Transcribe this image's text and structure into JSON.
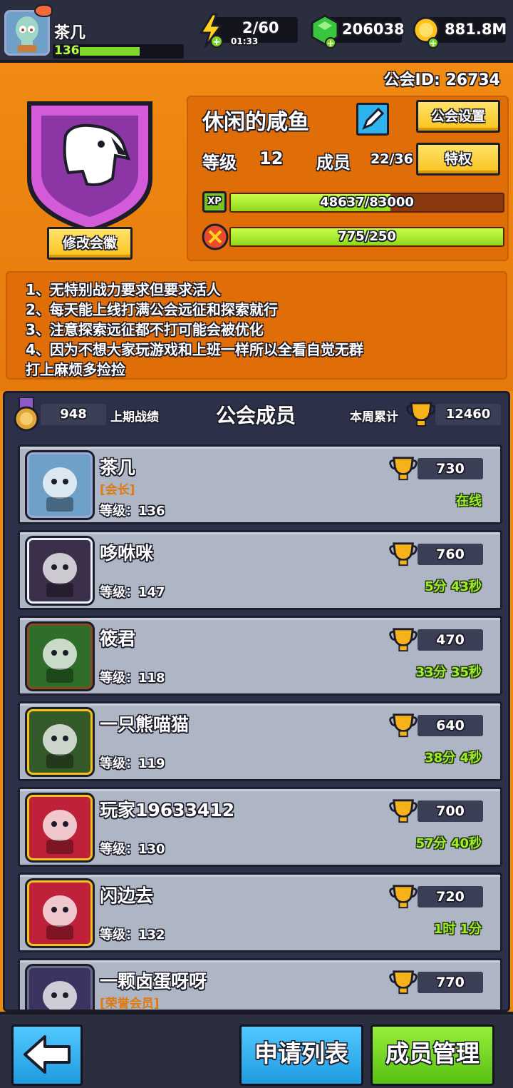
{
  "player": {
    "name": "茶几",
    "level": "136",
    "level_progress": 0.6
  },
  "resources": {
    "energy": "2/60",
    "energy_timer": "01:33",
    "gems": "206038",
    "coins": "881.8M"
  },
  "guild": {
    "id_label": "公会ID: 26734",
    "name": "休闲的咸鱼",
    "settings_button": "公会设置",
    "level_label": "等级",
    "level": "12",
    "members_label": "成员",
    "members_count": "22/36",
    "privilege_button": "特权",
    "xp_icon": "XP",
    "xp_text": "48637/83000",
    "xp_progress": 0.586,
    "battle_text": "775/250",
    "battle_progress": 1.0,
    "change_emblem_button": "修改会徽",
    "notice": [
      "1、无特别战力要求但要求活人",
      "2、每天能上线打满公会远征和探索就行",
      "3、注意探索远征都不打可能会被优化",
      "4、因为不想大家玩游戏和上班一样所以全看自觉无群",
      "打上麻烦多捡捡"
    ]
  },
  "members_panel": {
    "medal_value": "948",
    "last_label": "上期战绩",
    "title": "公会成员",
    "weekly_label": "本周累计",
    "weekly_value": "12460"
  },
  "members": [
    {
      "name": "茶几",
      "role": "[会长]",
      "level": "等级：136",
      "score": "730",
      "status": "在线",
      "color": "#6fa0c8",
      "frame": "#9aa8d8"
    },
    {
      "name": "哆咻咪",
      "role": "",
      "level": "等级：147",
      "score": "760",
      "status": "5分 43秒",
      "color": "#3b2f4a",
      "frame": "#e8f4ff"
    },
    {
      "name": "筱君",
      "role": "",
      "level": "等级：118",
      "score": "470",
      "status": "33分 35秒",
      "color": "#2f6e2a",
      "frame": "#8a4a20"
    },
    {
      "name": "一只熊喵猫",
      "role": "",
      "level": "等级：119",
      "score": "640",
      "status": "38分 4秒",
      "color": "#355a2a",
      "frame": "#f3c21b"
    },
    {
      "name": "玩家19633412",
      "role": "",
      "level": "等级：130",
      "score": "700",
      "status": "57分 40秒",
      "color": "#c0213a",
      "frame": "#f3c21b"
    },
    {
      "name": "闪边去",
      "role": "",
      "level": "等级：132",
      "score": "720",
      "status": "1时 1分",
      "color": "#c0213a",
      "frame": "#f3c21b"
    },
    {
      "name": "一颗卤蛋呀呀",
      "role": "[荣誉会员]",
      "level": "",
      "score": "770",
      "status": "",
      "color": "#3b3460",
      "frame": "#6a6a8a"
    }
  ],
  "bottom": {
    "apply_list": "申请列表",
    "member_manage": "成员管理"
  },
  "colors": {
    "orange": "#ea8a10",
    "dark": "#2b2e3f",
    "green_status": "#9bef2a",
    "yellow_button": "#f9c21b",
    "blue_button": "#2fb3ef",
    "green_button": "#6fd41a"
  }
}
